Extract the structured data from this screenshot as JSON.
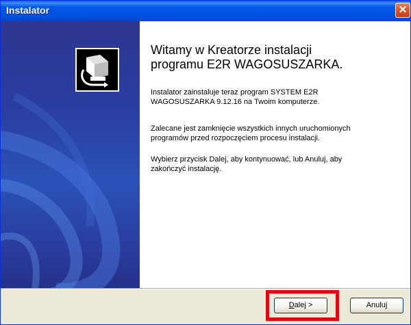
{
  "window": {
    "title": "Instalator",
    "close_label": "✕"
  },
  "content": {
    "heading_line1": "Witamy w Kreatorze instalacji",
    "heading_line2": "programu E2R WAGOSUSZARKA.",
    "para1_line1": "Instalator zainstaluje teraz program SYSTEM E2R",
    "para1_line2": "WAGOSUSZARKA 9.12.16 na Twoim komputerze.",
    "para2_line1": "Zalecane jest zamknięcie wszystkich innych uruchomionych",
    "para2_line2": "programów przed rozpoczęciem procesu instalacji.",
    "para3_line1": "Wybierz przycisk Dalej, aby kontynuować, lub Anuluj, aby",
    "para3_line2": "zakończyć instalację."
  },
  "buttons": {
    "next_mnemonic": "D",
    "next_rest": "alej >",
    "cancel": "Anuluj"
  },
  "colors": {
    "highlight": "#e30613",
    "titlebar": "#0053e2",
    "side_panel": "#2a3fa3"
  }
}
